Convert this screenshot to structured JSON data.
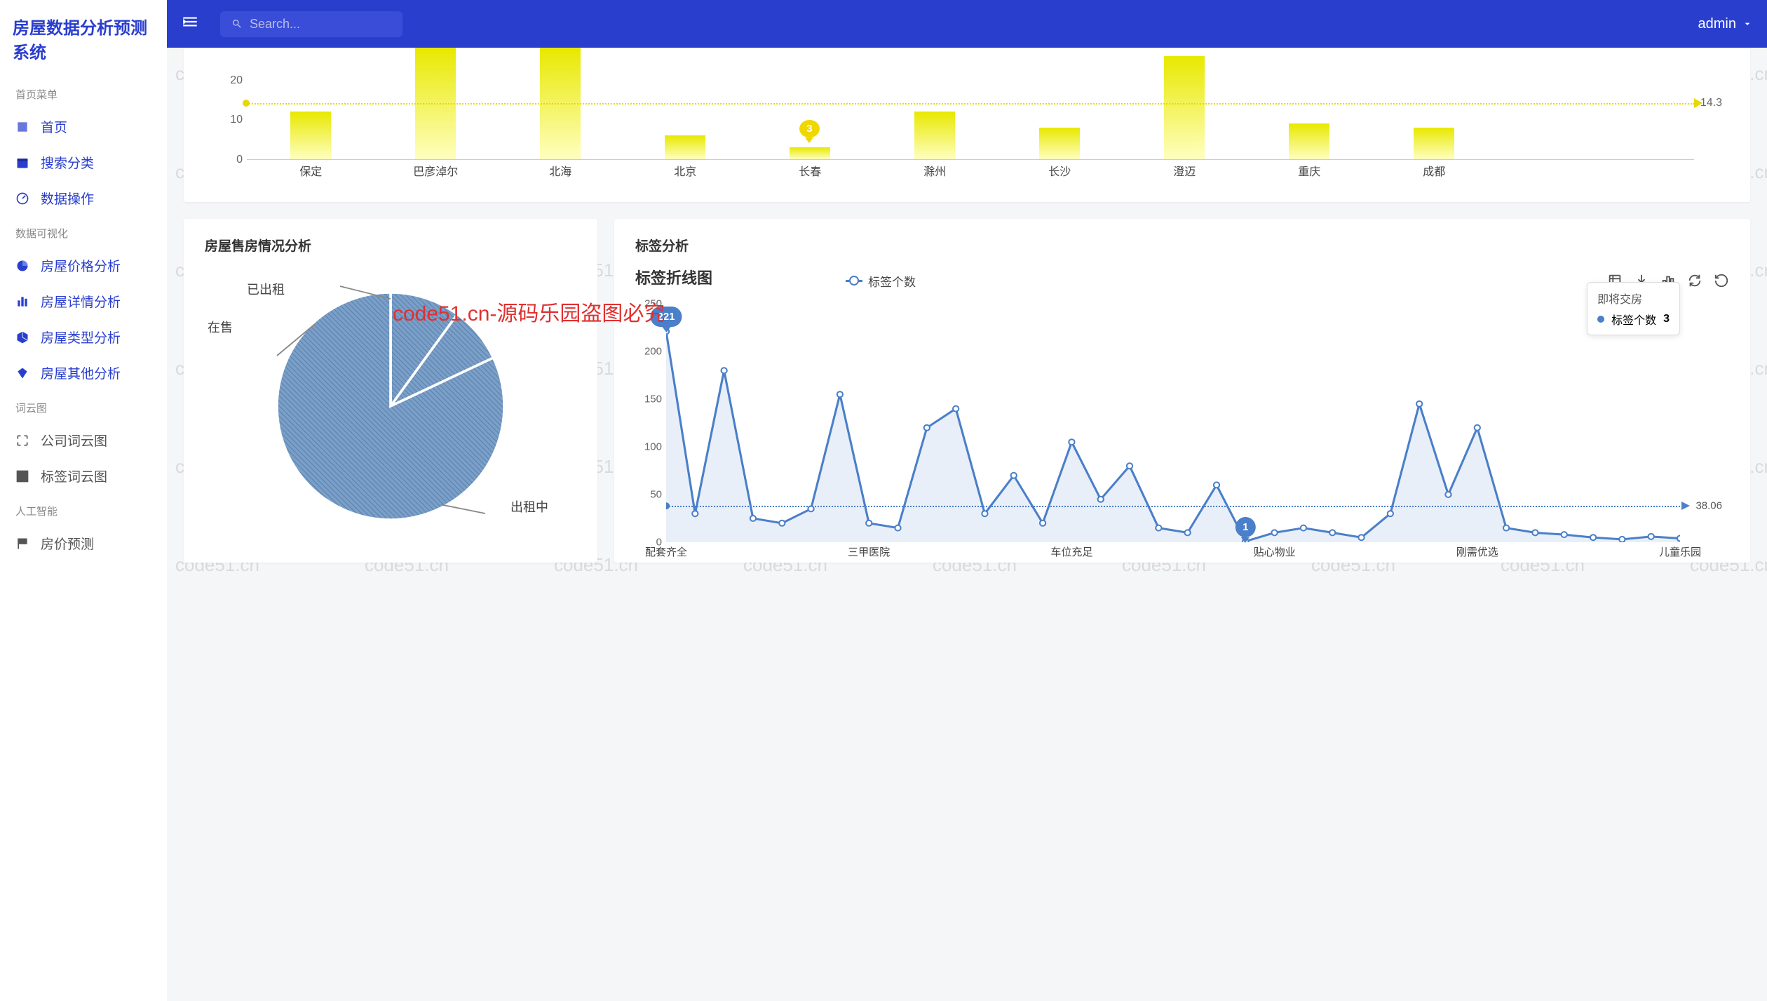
{
  "app_title": "房屋数据分析预测系统",
  "watermark_text": "code51.cn",
  "overlay_text": "code51.cn-源码乐园盗图必究",
  "header": {
    "search_placeholder": "Search...",
    "user_label": "admin"
  },
  "sidebar": {
    "sections": [
      {
        "title": "首页菜单",
        "items": [
          {
            "label": "首页",
            "name": "nav-home",
            "icon": "home-icon"
          },
          {
            "label": "搜索分类",
            "name": "nav-search-category",
            "icon": "calendar-icon"
          },
          {
            "label": "数据操作",
            "name": "nav-data-ops",
            "icon": "speed-icon"
          }
        ]
      },
      {
        "title": "数据可视化",
        "items": [
          {
            "label": "房屋价格分析",
            "name": "nav-price-analysis",
            "icon": "pie-icon"
          },
          {
            "label": "房屋详情分析",
            "name": "nav-detail-analysis",
            "icon": "bars-icon"
          },
          {
            "label": "房屋类型分析",
            "name": "nav-type-analysis",
            "icon": "cube-icon"
          },
          {
            "label": "房屋其他分析",
            "name": "nav-other-analysis",
            "icon": "diamond-icon"
          }
        ]
      },
      {
        "title": "词云图",
        "items": [
          {
            "label": "公司词云图",
            "name": "nav-company-cloud",
            "icon": "expand-icon",
            "muted": true
          },
          {
            "label": "标签词云图",
            "name": "nav-tag-cloud",
            "icon": "grid-icon",
            "muted": true
          }
        ]
      },
      {
        "title": "人工智能",
        "items": [
          {
            "label": "房价预测",
            "name": "nav-price-predict",
            "icon": "flag-icon",
            "muted": true
          }
        ]
      }
    ]
  },
  "bar_chart_card": {
    "avg_label": "14.3",
    "tooltip_value": "3"
  },
  "pie_chart_card": {
    "title": "房屋售房情况分析",
    "labels": {
      "rented": "已出租",
      "onsale": "在售",
      "renting": "出租中"
    }
  },
  "line_chart_card": {
    "title": "标签分析",
    "chart_title": "标签折线图",
    "legend_label": "标签个数",
    "max_marker": "221",
    "min_marker": "1",
    "avg_label": "38.06",
    "tooltip": {
      "category": "即将交房",
      "series": "标签个数",
      "value": "3"
    }
  },
  "chart_data": [
    {
      "type": "bar",
      "title": "",
      "categories": [
        "保定",
        "巴彦淖尔",
        "北海",
        "北京",
        "长春",
        "滁州",
        "长沙",
        "澄迈",
        "重庆",
        "成都"
      ],
      "values": [
        12,
        28,
        28,
        6,
        3,
        12,
        8,
        26,
        9,
        8
      ],
      "ylim": [
        0,
        30
      ],
      "yticks": [
        0,
        10,
        20
      ],
      "avg_line": 14.3,
      "highlighted_index": 4
    },
    {
      "type": "pie",
      "title": "房屋售房情况分析",
      "slices": [
        {
          "name": "已出租",
          "value": 10
        },
        {
          "name": "在售",
          "value": 8
        },
        {
          "name": "出租中",
          "value": 82
        }
      ]
    },
    {
      "type": "line",
      "title": "标签折线图",
      "series_name": "标签个数",
      "xlabels_shown": [
        "配套齐全",
        "三甲医院",
        "车位充足",
        "贴心物业",
        "刚需优选",
        "儿童乐园"
      ],
      "x_count": 36,
      "values": [
        221,
        30,
        180,
        25,
        20,
        35,
        155,
        20,
        15,
        120,
        140,
        30,
        70,
        20,
        105,
        45,
        80,
        15,
        10,
        60,
        1,
        10,
        15,
        10,
        5,
        30,
        145,
        50,
        120,
        15,
        10,
        8,
        5,
        3,
        6,
        4
      ],
      "ylim": [
        0,
        250
      ],
      "yticks": [
        0,
        50,
        100,
        150,
        200,
        250
      ],
      "avg_line": 38.06,
      "max_marker": {
        "index": 0,
        "value": 221
      },
      "min_marker": {
        "index": 20,
        "value": 1
      },
      "tooltip_point": {
        "category": "即将交房",
        "value": 3
      }
    }
  ]
}
